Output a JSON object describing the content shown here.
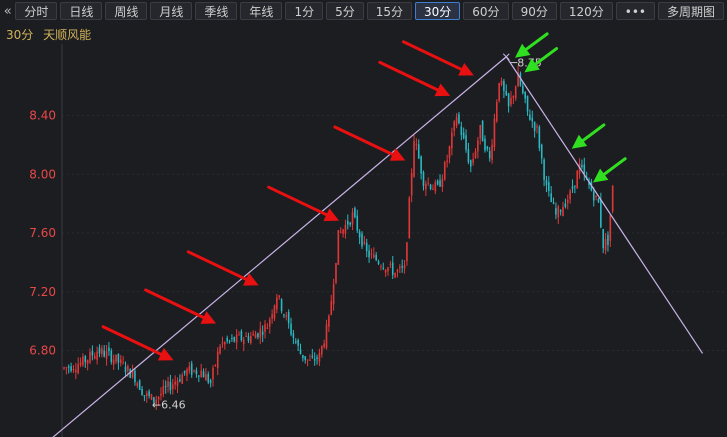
{
  "toolbar": {
    "back_icon": "double-left-chevron-icon",
    "back_glyph": "«",
    "tabs": [
      {
        "label": "分时",
        "active": false
      },
      {
        "label": "日线",
        "active": false
      },
      {
        "label": "周线",
        "active": false
      },
      {
        "label": "月线",
        "active": false
      },
      {
        "label": "季线",
        "active": false
      },
      {
        "label": "年线",
        "active": false
      },
      {
        "label": "1分",
        "active": false
      },
      {
        "label": "5分",
        "active": false
      },
      {
        "label": "15分",
        "active": false
      },
      {
        "label": "30分",
        "active": true
      },
      {
        "label": "60分",
        "active": false
      },
      {
        "label": "90分",
        "active": false
      },
      {
        "label": "120分",
        "active": false
      },
      {
        "label": "•••",
        "active": false
      },
      {
        "label": "多周期图",
        "active": false
      }
    ],
    "dropdown_icon": "chevron-down-icon"
  },
  "info": {
    "period": "30分",
    "name": "天顺风能"
  },
  "colors": {
    "up": "#e03838",
    "down": "#2ab8c2",
    "trend": "#c9b3e8",
    "arrow_red": "#e81010",
    "arrow_green": "#30e020",
    "axis_text": "#e84848"
  },
  "chart_data": {
    "type": "candlestick",
    "y_ticks": [
      6.8,
      7.2,
      7.6,
      8.0,
      8.4
    ],
    "ylim": [
      6.4,
      8.9
    ],
    "annotations": [
      {
        "label": "6.46",
        "kind": "low"
      },
      {
        "label": "8.75",
        "kind": "high"
      }
    ],
    "price_path": [
      [
        0,
        6.68
      ],
      [
        8,
        6.72
      ],
      [
        14,
        6.8
      ],
      [
        20,
        6.76
      ],
      [
        24,
        6.71
      ],
      [
        30,
        6.62
      ],
      [
        34,
        6.5
      ],
      [
        38,
        6.46
      ],
      [
        44,
        6.55
      ],
      [
        52,
        6.66
      ],
      [
        58,
        6.66
      ],
      [
        62,
        6.58
      ],
      [
        66,
        6.84
      ],
      [
        74,
        6.88
      ],
      [
        80,
        6.9
      ],
      [
        86,
        6.97
      ],
      [
        90,
        7.18
      ],
      [
        96,
        6.93
      ],
      [
        100,
        6.78
      ],
      [
        104,
        6.72
      ],
      [
        108,
        6.76
      ],
      [
        112,
        7.0
      ],
      [
        116,
        7.58
      ],
      [
        122,
        7.72
      ],
      [
        128,
        7.46
      ],
      [
        134,
        7.4
      ],
      [
        140,
        7.33
      ],
      [
        144,
        7.35
      ],
      [
        148,
        8.25
      ],
      [
        152,
        7.96
      ],
      [
        158,
        7.9
      ],
      [
        162,
        8.1
      ],
      [
        166,
        8.4
      ],
      [
        172,
        8.05
      ],
      [
        176,
        8.3
      ],
      [
        180,
        8.1
      ],
      [
        184,
        8.65
      ],
      [
        188,
        8.45
      ],
      [
        192,
        8.66
      ],
      [
        196,
        8.42
      ],
      [
        200,
        8.3
      ],
      [
        204,
        7.9
      ],
      [
        208,
        7.72
      ],
      [
        214,
        7.86
      ],
      [
        218,
        8.05
      ],
      [
        222,
        7.92
      ],
      [
        226,
        7.8
      ],
      [
        228,
        7.52
      ],
      [
        230,
        7.55
      ],
      [
        232,
        7.9
      ]
    ],
    "trend_lines": [
      {
        "name": "support",
        "from": {
          "bar": -15,
          "price": 6.07
        },
        "to": {
          "bar": 187,
          "price": 8.8
        }
      },
      {
        "name": "resistance",
        "from": {
          "bar": 187,
          "price": 8.8
        },
        "to": {
          "bar": 270,
          "price": 6.78
        }
      }
    ],
    "red_arrows": [
      {
        "touch_bar": 48,
        "price": 6.72
      },
      {
        "touch_bar": 66,
        "price": 6.97
      },
      {
        "touch_bar": 84,
        "price": 7.23
      },
      {
        "touch_bar": 118,
        "price": 7.67
      },
      {
        "touch_bar": 146,
        "price": 8.08
      },
      {
        "touch_bar": 165,
        "price": 8.52
      },
      {
        "touch_bar": 175,
        "price": 8.66
      }
    ],
    "green_arrows": [
      {
        "touch_bar": 189,
        "price": 8.78
      },
      {
        "touch_bar": 193,
        "price": 8.68
      },
      {
        "touch_bar": 213,
        "price": 8.16
      },
      {
        "touch_bar": 222,
        "price": 7.93
      }
    ]
  }
}
